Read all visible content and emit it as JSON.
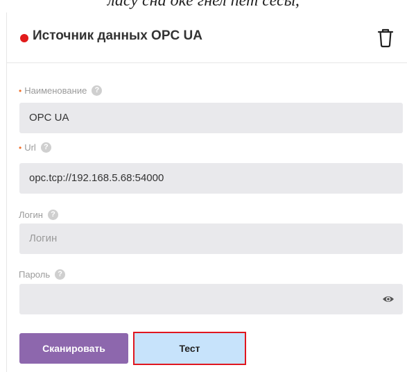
{
  "caption": "ласу сна оке гнел пет сесы,",
  "panel": {
    "title": "Источник данных OPC UA",
    "status_color": "#e11b1b",
    "delete_icon": "trash-icon"
  },
  "fields": {
    "name": {
      "label": "Наименование",
      "required": true,
      "value": "OPC UA"
    },
    "url": {
      "label": "Url",
      "required": true,
      "value": "opc.tcp://192.168.5.68:54000"
    },
    "login": {
      "label": "Логин",
      "required": false,
      "placeholder": "Логин",
      "value": ""
    },
    "password": {
      "label": "Пароль",
      "required": false,
      "value": "",
      "toggle_icon": "eye-icon"
    }
  },
  "buttons": {
    "scan": "Сканировать",
    "test": "Тест"
  },
  "help_glyph": "?",
  "required_glyph": "•",
  "colors": {
    "accent_purple": "#8d67ad",
    "test_button_bg": "#c7e3fb",
    "highlight_red": "#e0161f",
    "required_orange": "#f0702b"
  }
}
